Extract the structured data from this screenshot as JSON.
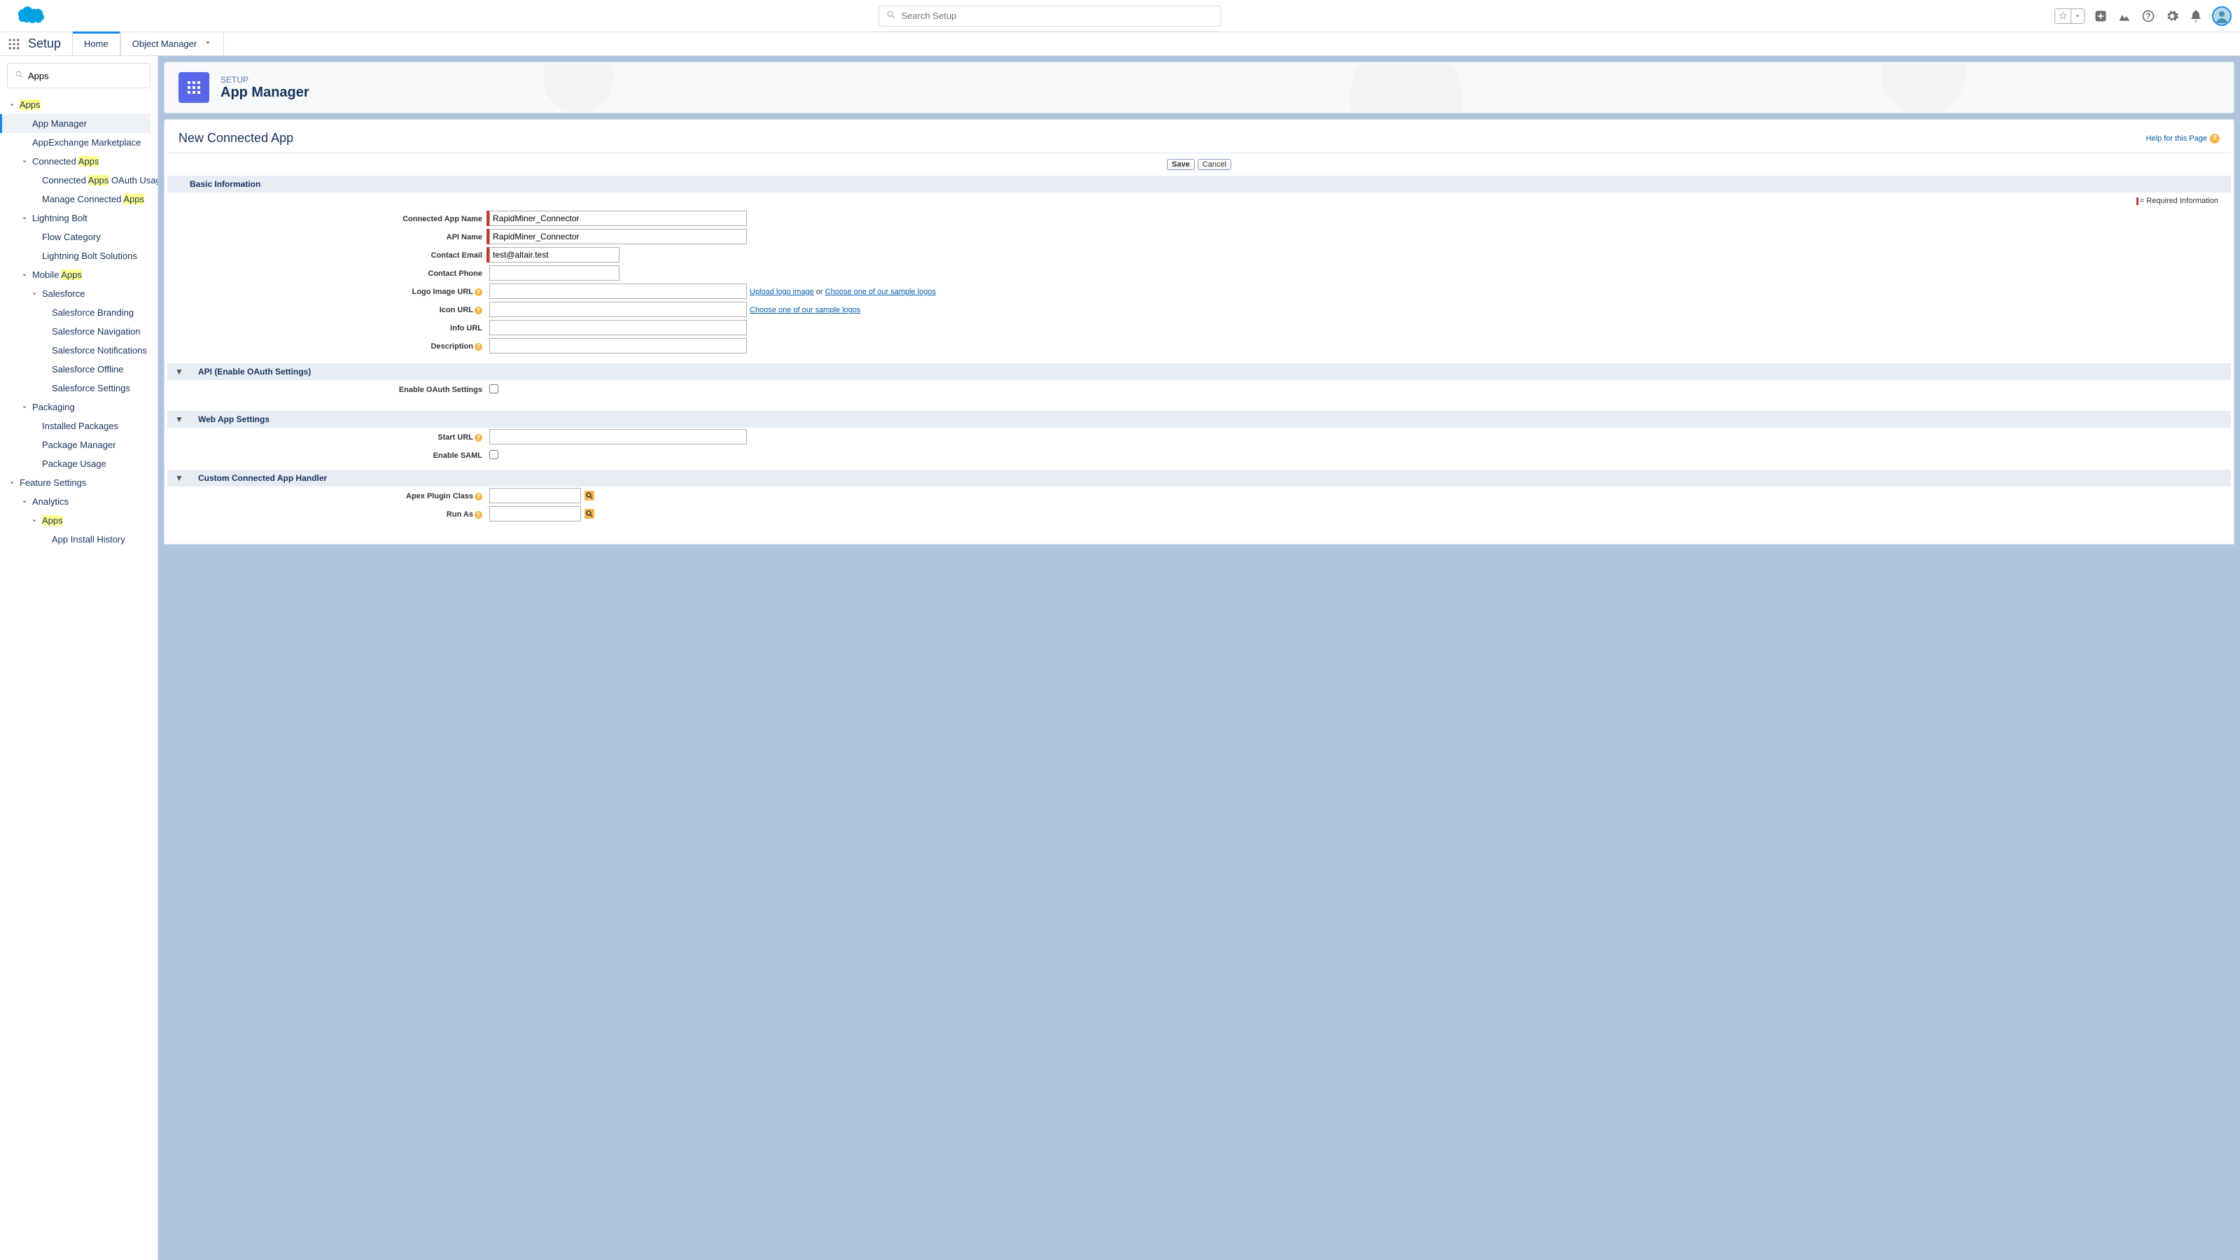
{
  "header": {
    "search_placeholder": "Search Setup"
  },
  "nav": {
    "setup_label": "Setup",
    "tabs": {
      "home": "Home",
      "object_manager": "Object Manager"
    }
  },
  "sidebar": {
    "quick_find_value": "Apps",
    "apps_label": "Apps",
    "app_manager": "App Manager",
    "appexchange": "AppExchange Marketplace",
    "connected_apps_pre": "Connected ",
    "connected_apps_hl": "Apps",
    "connected_apps_oauth_pre": "Connected ",
    "connected_apps_oauth_hl": "Apps",
    "connected_apps_oauth_post": " OAuth Usage",
    "manage_connected_pre": "Manage Connected ",
    "manage_connected_hl": "Apps",
    "lightning_bolt": "Lightning Bolt",
    "flow_category": "Flow Category",
    "lightning_bolt_solutions": "Lightning Bolt Solutions",
    "mobile_pre": "Mobile ",
    "mobile_hl": "Apps",
    "salesforce": "Salesforce",
    "sf_branding": "Salesforce Branding",
    "sf_navigation": "Salesforce Navigation",
    "sf_notifications": "Salesforce Notifications",
    "sf_offline": "Salesforce Offline",
    "sf_settings": "Salesforce Settings",
    "packaging": "Packaging",
    "installed_packages": "Installed Packages",
    "package_manager": "Package Manager",
    "package_usage": "Package Usage",
    "feature_settings": "Feature Settings",
    "analytics": "Analytics",
    "analytics_apps": "Apps",
    "app_install_history": "App Install History"
  },
  "banner": {
    "eyebrow": "SETUP",
    "title": "App Manager"
  },
  "form": {
    "page_title": "New Connected App",
    "help_link": "Help for this Page",
    "save": "Save",
    "cancel": "Cancel",
    "required_note": "= Required Information",
    "sections": {
      "basic": "Basic Information",
      "api": "API (Enable OAuth Settings)",
      "webapp": "Web App Settings",
      "handler": "Custom Connected App Handler"
    },
    "labels": {
      "connected_app_name": "Connected App Name",
      "api_name": "API Name",
      "contact_email": "Contact Email",
      "contact_phone": "Contact Phone",
      "logo_image_url": "Logo Image URL",
      "icon_url": "Icon URL",
      "info_url": "Info URL",
      "description": "Description",
      "enable_oauth": "Enable OAuth Settings",
      "start_url": "Start URL",
      "enable_saml": "Enable SAML",
      "apex_plugin_class": "Apex Plugin Class",
      "run_as": "Run As"
    },
    "values": {
      "connected_app_name": "RapidMiner_Connector",
      "api_name": "RapidMiner_Connector",
      "contact_email": "test@altair.test",
      "contact_phone": "",
      "logo_image_url": "",
      "icon_url": "",
      "info_url": "",
      "description": "",
      "start_url": "",
      "apex_plugin_class": "",
      "run_as": ""
    },
    "links": {
      "upload_logo": "Upload logo image",
      "or": " or ",
      "sample_logos": "Choose one of our sample logos"
    }
  }
}
